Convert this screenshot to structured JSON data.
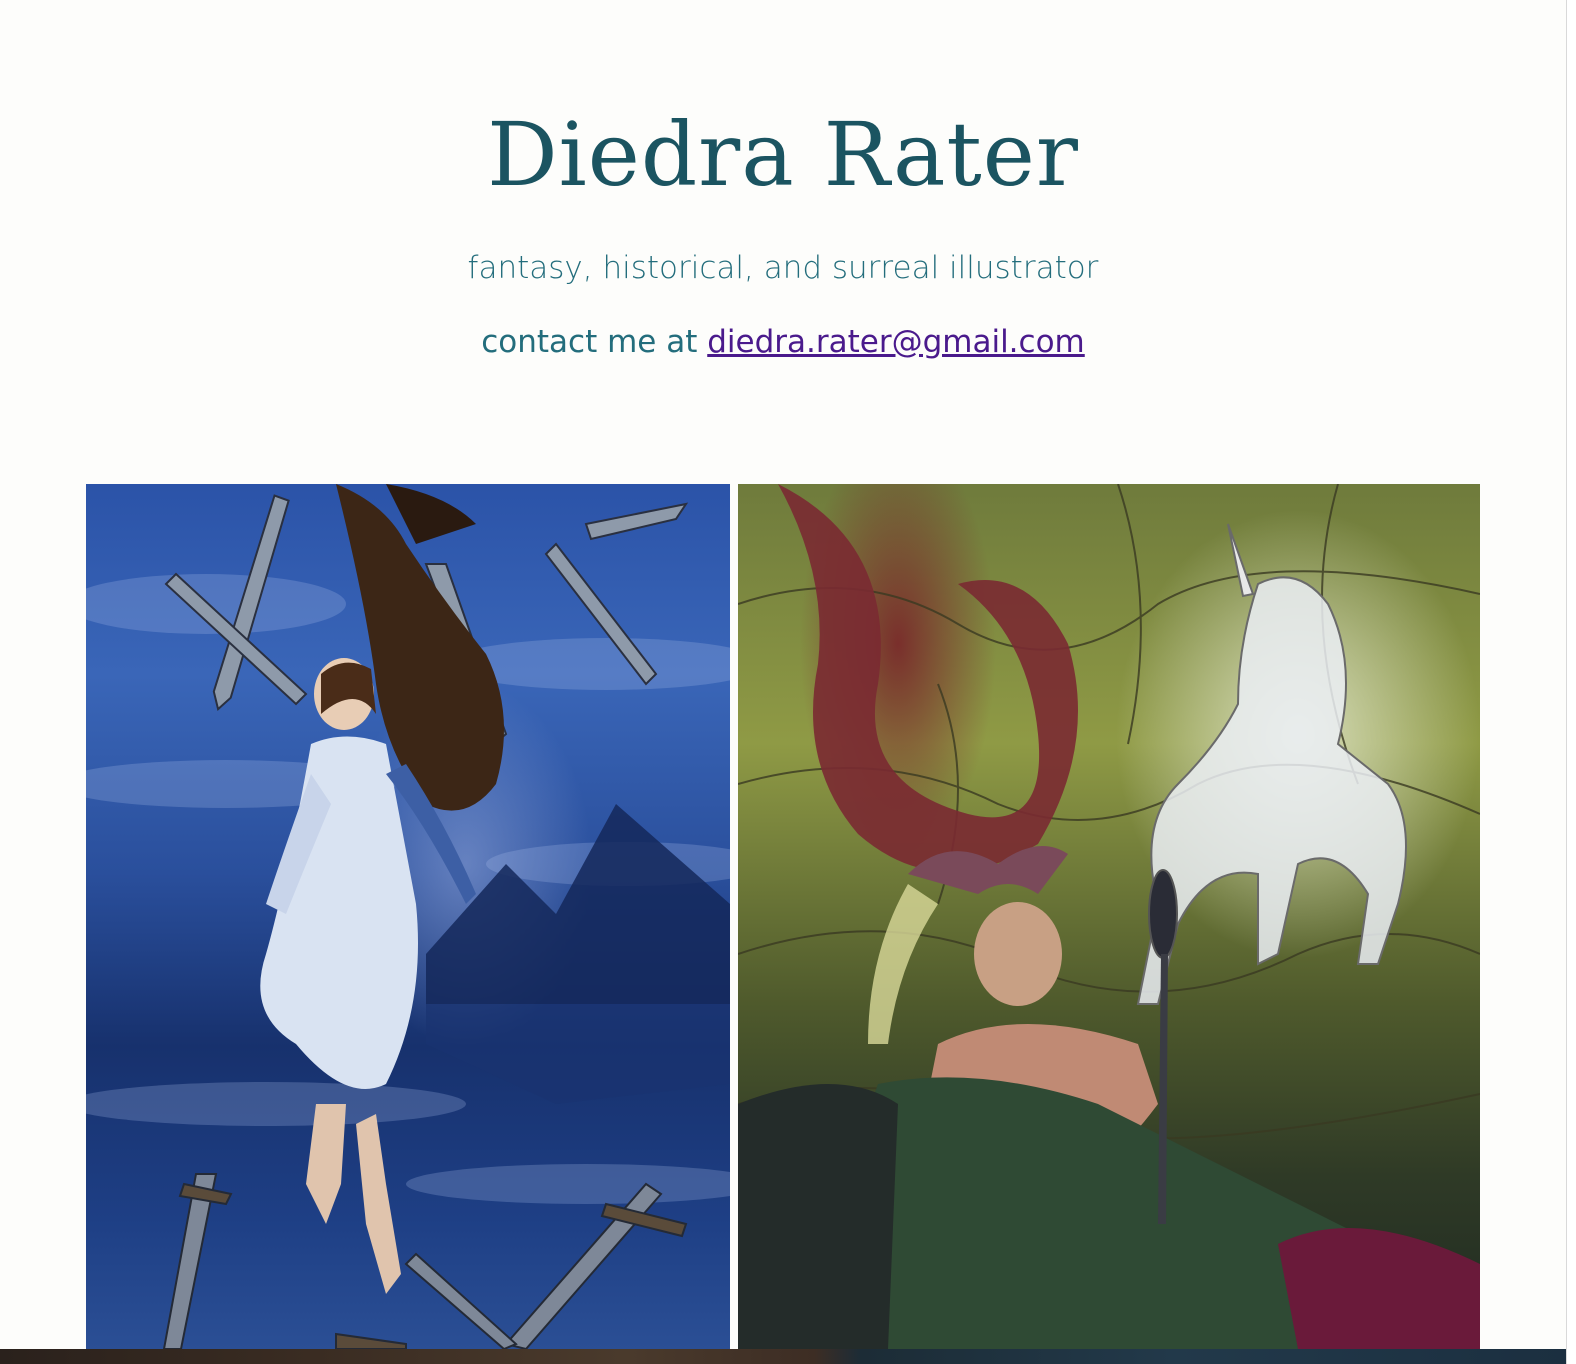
{
  "site": {
    "title": "Diedra Rater",
    "tagline": "fantasy, historical, and surreal illustrator",
    "contact_prefix": "contact me at ",
    "email": "diedra.rater@gmail.com"
  },
  "gallery": {
    "images": [
      {
        "name": "Floating woman with swords"
      },
      {
        "name": "Woman with mirror before stained-glass unicorn"
      }
    ]
  }
}
